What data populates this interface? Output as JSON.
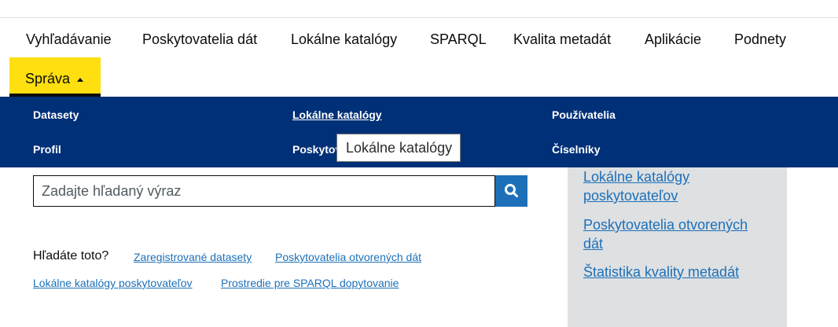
{
  "nav": {
    "items": [
      "Vyhľadávanie",
      "Poskytovatelia dát",
      "Lokálne katalógy",
      "SPARQL",
      "Kvalita metadát",
      "Aplikácie",
      "Podnety"
    ],
    "active_label": "Správa",
    "active_caret": "caret-up-icon"
  },
  "dropdown": {
    "col1": [
      "Datasety",
      "Profil"
    ],
    "col2": [
      "Lokálne katalógy",
      "Poskytovatelia"
    ],
    "col3": [
      "Používatelia",
      "Číselníky"
    ]
  },
  "tooltip": {
    "text": "Lokálne katalógy"
  },
  "search": {
    "placeholder": "Zadajte hľadaný výraz",
    "button_icon": "search-icon"
  },
  "hints": {
    "label": "Hľadáte toto?",
    "links": [
      "Zaregistrované datasety",
      "Poskytovatelia otvorených dát",
      "Lokálne katalógy poskytovateľov",
      "Prostredie pre SPARQL dopytovanie"
    ]
  },
  "sidebar": {
    "links": [
      "Lokálne katalógy poskytovateľov",
      "Poskytovatelia otvorených dát",
      "Štatistika kvality metadát"
    ]
  },
  "colors": {
    "accent_yellow": "#ffdf0f",
    "dropdown_blue": "#003078",
    "link_blue": "#1d70b8",
    "sidebar_gray": "#dee0e2"
  }
}
